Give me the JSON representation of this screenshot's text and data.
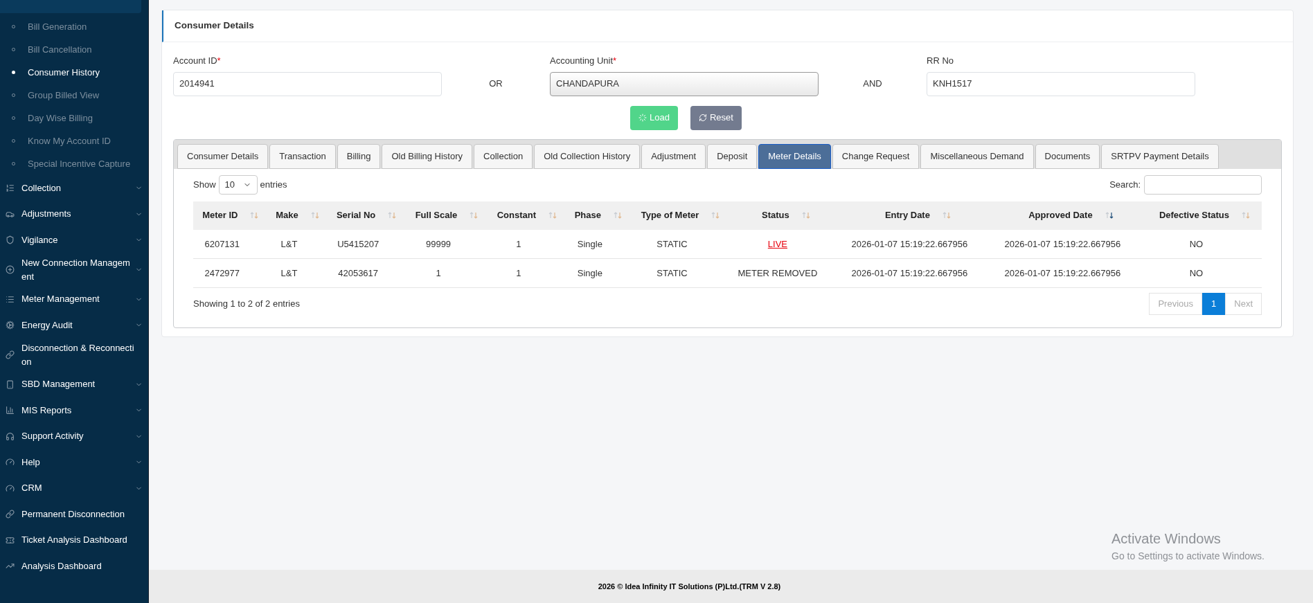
{
  "sidebar": {
    "submenu": [
      {
        "label": "Bill Generation",
        "selected": false
      },
      {
        "label": "Bill Cancellation",
        "selected": false
      },
      {
        "label": "Consumer History",
        "selected": true
      },
      {
        "label": "Group Billed View",
        "selected": false
      },
      {
        "label": "Day Wise Billing",
        "selected": false
      },
      {
        "label": "Know My Account ID",
        "selected": false
      },
      {
        "label": "Special Incentive Capture",
        "selected": false
      }
    ],
    "items": [
      {
        "label": "Collection",
        "expandable": true
      },
      {
        "label": "Adjustments",
        "expandable": true
      },
      {
        "label": "Vigilance",
        "expandable": true
      },
      {
        "label": "New Connection Management",
        "expandable": true
      },
      {
        "label": "Meter Management",
        "expandable": true
      },
      {
        "label": "Energy Audit",
        "expandable": true
      },
      {
        "label": "Disconnection & Reconnection",
        "expandable": false
      },
      {
        "label": "SBD Management",
        "expandable": true
      },
      {
        "label": "MIS Reports",
        "expandable": true
      },
      {
        "label": "Support Activity",
        "expandable": true
      },
      {
        "label": "Help",
        "expandable": true
      },
      {
        "label": "CRM",
        "expandable": true
      },
      {
        "label": "Permanent Disconnection",
        "expandable": false
      },
      {
        "label": "Ticket Analysis Dashboard",
        "expandable": false
      },
      {
        "label": "Analysis Dashboard",
        "expandable": false
      }
    ]
  },
  "card": {
    "title": "Consumer Details",
    "fields": [
      {
        "label": "Account ID",
        "required_mark": "*",
        "value": "2014941",
        "kind": "input"
      },
      {
        "label": "Accounting Unit",
        "required_mark": "*",
        "value": "CHANDAPURA",
        "kind": "select"
      },
      {
        "label": "RR No",
        "value": "KNH1517",
        "kind": "input"
      }
    ],
    "connectors": [
      "OR",
      "AND"
    ],
    "buttons": [
      {
        "label": "Load",
        "kind": "load"
      },
      {
        "label": "Reset",
        "kind": "reset"
      }
    ]
  },
  "tabs": [
    {
      "label": "Consumer Details",
      "selected": false
    },
    {
      "label": "Transaction",
      "selected": false
    },
    {
      "label": "Billing",
      "selected": false
    },
    {
      "label": "Old Billing History",
      "selected": false
    },
    {
      "label": "Collection",
      "selected": false
    },
    {
      "label": "Old Collection History",
      "selected": false
    },
    {
      "label": "Adjustment",
      "selected": false
    },
    {
      "label": "Deposit",
      "selected": false
    },
    {
      "label": "Meter Details",
      "selected": true
    },
    {
      "label": "Change Request",
      "selected": false
    },
    {
      "label": "Miscellaneous Demand",
      "selected": false
    },
    {
      "label": "Documents",
      "selected": false
    },
    {
      "label": "SRTPV Payment Details",
      "selected": false
    }
  ],
  "table": {
    "show_label": "Show",
    "entries_value": "10",
    "entries_label": "entries",
    "search_label": "Search:",
    "columns": [
      {
        "label": "Meter ID",
        "sorted": false
      },
      {
        "label": "Make",
        "sorted": false
      },
      {
        "label": "Serial No",
        "sorted": false
      },
      {
        "label": "Full Scale",
        "sorted": false
      },
      {
        "label": "Constant",
        "sorted": false
      },
      {
        "label": "Phase",
        "sorted": false
      },
      {
        "label": "Type of Meter",
        "sorted": false
      },
      {
        "label": "Status",
        "sorted": false
      },
      {
        "label": "Entry Date",
        "sorted": false
      },
      {
        "label": "Approved Date",
        "sorted": true
      },
      {
        "label": "Defective Status",
        "sorted": false
      }
    ],
    "rows": [
      {
        "status_link": true,
        "cells": [
          "6207131",
          "L&T",
          "U5415207",
          "99999",
          "1",
          "Single",
          "STATIC",
          "LIVE",
          "2026-01-07 15:19:22.667956",
          "2026-01-07 15:19:22.667956",
          "NO"
        ]
      },
      {
        "status_link": false,
        "cells": [
          "2472977",
          "L&T",
          "42053617",
          "1",
          "1",
          "Single",
          "STATIC",
          "METER REMOVED",
          "2026-01-07 15:19:22.667956",
          "2026-01-07 15:19:22.667956",
          "NO"
        ]
      }
    ],
    "info": "Showing 1 to 2 of 2 entries",
    "pages": [
      {
        "label": "Previous",
        "disabled": true,
        "selected": false
      },
      {
        "label": "1",
        "disabled": false,
        "selected": true
      },
      {
        "label": "Next",
        "disabled": true,
        "selected": false
      }
    ]
  },
  "watermark": {
    "title": "Activate Windows",
    "subtitle": "Go to Settings to activate Windows."
  },
  "footer": "2026 © Idea Infinity IT Solutions (P)Ltd.(TRM V 2.8)"
}
